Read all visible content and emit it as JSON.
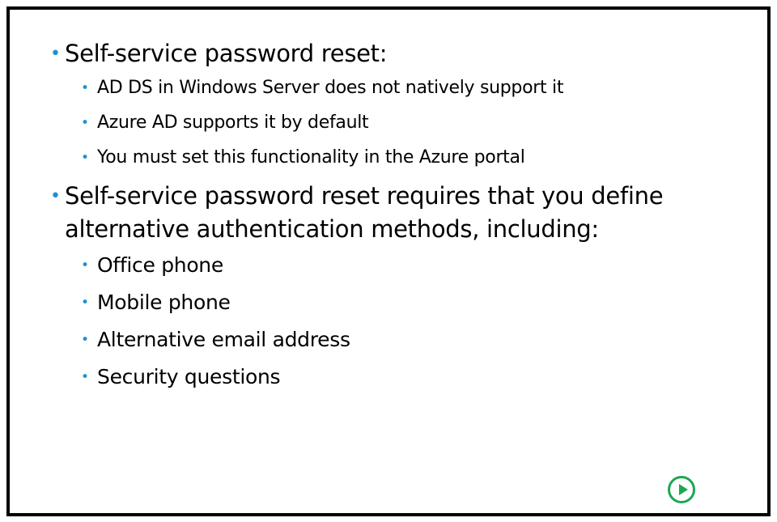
{
  "bullet_color": "#1f8fd6",
  "accent_color": "#1aa850",
  "bullet_symbol": "•",
  "slide": {
    "items": [
      {
        "text": "Self-service password reset:",
        "subitems": [
          "AD DS in Windows Server does not natively support it",
          "Azure AD supports it by default",
          "You must set this functionality in the Azure portal"
        ]
      },
      {
        "text": "Self-service password reset requires that you define alternative authentication methods, including:",
        "subitems": [
          "Office phone",
          "Mobile phone",
          "Alternative email address",
          "Security questions"
        ]
      }
    ]
  },
  "controls": {
    "next_icon": "play-circle-icon"
  }
}
